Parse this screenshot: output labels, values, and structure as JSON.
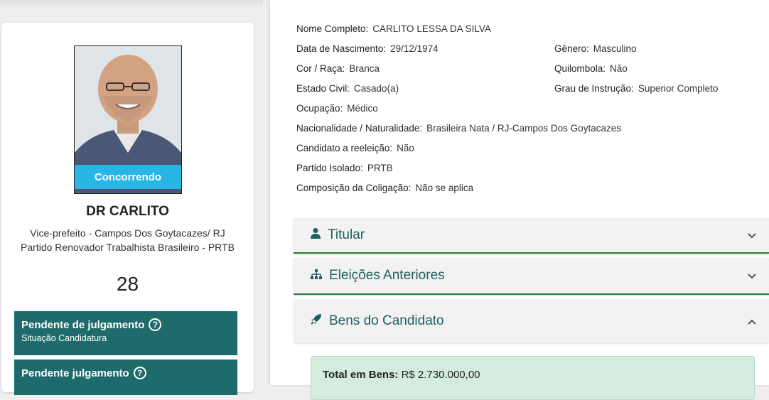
{
  "candidate": {
    "status": "Concorrendo",
    "name": "DR CARLITO",
    "role": "Vice-prefeito - Campos Dos Goytacazes/ RJ",
    "party": "Partido Renovador Trabalhista Brasileiro - PRTB",
    "number": "28"
  },
  "status_boxes": [
    {
      "title": "Pendente de julgamento",
      "subtitle": "Situação Candidatura"
    },
    {
      "title": "Pendente julgamento",
      "subtitle": ""
    }
  ],
  "details": {
    "nome_completo": {
      "label": "Nome Completo:",
      "value": "CARLITO LESSA DA SILVA"
    },
    "data_nascimento": {
      "label": "Data de Nascimento:",
      "value": "29/12/1974"
    },
    "genero": {
      "label": "Gênero:",
      "value": "Masculino"
    },
    "cor_raca": {
      "label": "Cor / Raça:",
      "value": "Branca"
    },
    "quilombola": {
      "label": "Quilombola:",
      "value": "Não"
    },
    "estado_civil": {
      "label": "Estado Civil:",
      "value": "Casado(a)"
    },
    "grau_instrucao": {
      "label": "Grau de Instrução:",
      "value": "Superior Completo"
    },
    "ocupacao": {
      "label": "Ocupação:",
      "value": "Médico"
    },
    "nacionalidade": {
      "label": "Nacionalidade / Naturalidade:",
      "value": "Brasileira Nata / RJ-Campos Dos Goytacazes"
    },
    "reeleicao": {
      "label": "Candidato a reeleição:",
      "value": "Não"
    },
    "partido_isolado": {
      "label": "Partido Isolado:",
      "value": "PRTB"
    },
    "composicao": {
      "label": "Composição da Coligação:",
      "value": "Não se aplica"
    }
  },
  "accordions": [
    {
      "label": "Titular",
      "icon": "person-icon",
      "expanded": false
    },
    {
      "label": "Eleições Anteriores",
      "icon": "sitemap-icon",
      "expanded": false
    },
    {
      "label": "Bens do Candidato",
      "icon": "rocket-icon",
      "expanded": true
    }
  ],
  "bens": {
    "total_label": "Total em Bens:",
    "total_value": "R$ 2.730.000,00"
  },
  "colors": {
    "teal": "#1f6b6b",
    "chip": "#29b6e6",
    "accent_border": "#2e7d32",
    "green_box": "#d4ecde"
  }
}
